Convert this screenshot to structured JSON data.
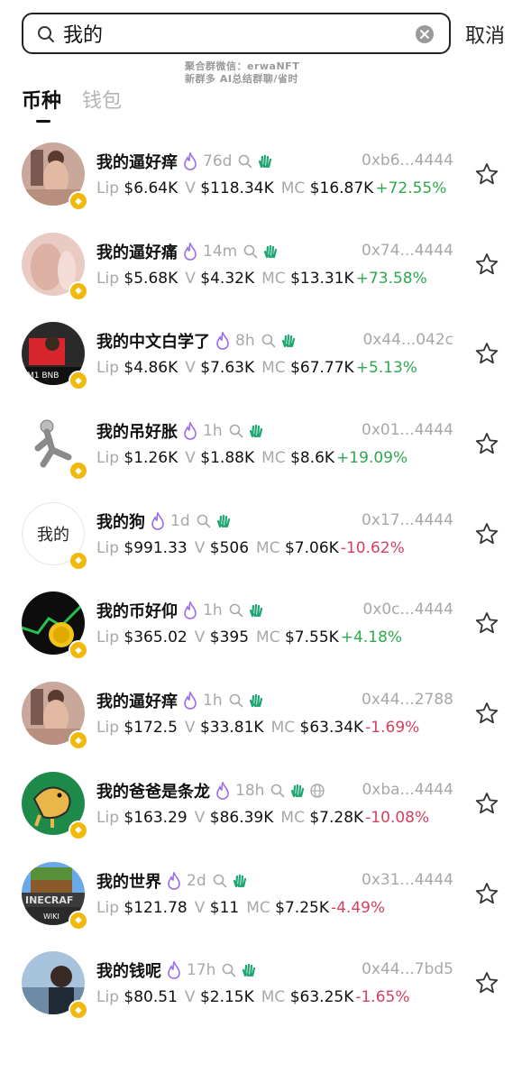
{
  "search": {
    "value": "我的",
    "cancel_label": "取消"
  },
  "watermark": {
    "line1": "聚合群微信：erwaNFT",
    "line2": "新群多 AI总结群聊/省时"
  },
  "tabs": [
    {
      "label": "币种"
    },
    {
      "label": "钱包"
    }
  ],
  "colors": {
    "positive": "#2fa84f",
    "negative": "#d6405f",
    "fire": "#9b6cf0",
    "hand": "#1ea672",
    "badge": "#f0b90b"
  },
  "tokens": [
    {
      "name": "我的逼好痒",
      "age": "76d",
      "addr": "0xb6...4444",
      "lip_label": "Lip",
      "lip": "$6.64K",
      "v_label": "V",
      "v": "$118.34K",
      "mc_label": "MC",
      "mc": "$16.87K",
      "change": "+72.55%",
      "dir": "pos",
      "avatar": "photo-skin",
      "globe": false
    },
    {
      "name": "我的逼好痛",
      "age": "14m",
      "addr": "0x74...4444",
      "lip_label": "Lip",
      "lip": "$5.68K",
      "v_label": "V",
      "v": "$4.32K",
      "mc_label": "MC",
      "mc": "$13.31K",
      "change": "+73.58%",
      "dir": "pos",
      "avatar": "photo-pink",
      "globe": false
    },
    {
      "name": "我的中文白学了",
      "age": "8h",
      "addr": "0x44...042c",
      "lip_label": "Lip",
      "lip": "$4.86K",
      "v_label": "V",
      "v": "$7.63K",
      "mc_label": "MC",
      "mc": "$67.77K",
      "change": "+5.13%",
      "dir": "pos",
      "avatar": "photo-red",
      "globe": false
    },
    {
      "name": "我的吊好胀",
      "age": "1h",
      "addr": "0x01...4444",
      "lip_label": "Lip",
      "lip": "$1.26K",
      "v_label": "V",
      "v": "$1.88K",
      "mc_label": "MC",
      "mc": "$8.6K",
      "change": "+19.09%",
      "dir": "pos",
      "avatar": "figure-grey",
      "globe": false
    },
    {
      "name": "我的狗",
      "age": "1d",
      "addr": "0x17...4444",
      "lip_label": "Lip",
      "lip": "$991.33",
      "v_label": "V",
      "v": "$506",
      "mc_label": "MC",
      "mc": "$7.06K",
      "change": "-10.62%",
      "dir": "neg",
      "avatar": "text",
      "avatar_text": "我的",
      "globe": false
    },
    {
      "name": "我的币好仰",
      "age": "1h",
      "addr": "0x0c...4444",
      "lip_label": "Lip",
      "lip": "$365.02",
      "v_label": "V",
      "v": "$395",
      "mc_label": "MC",
      "mc": "$7.55K",
      "change": "+4.18%",
      "dir": "pos",
      "avatar": "coin-dark",
      "globe": false
    },
    {
      "name": "我的逼好痒",
      "age": "1h",
      "addr": "0x44...2788",
      "lip_label": "Lip",
      "lip": "$172.5",
      "v_label": "V",
      "v": "$33.81K",
      "mc_label": "MC",
      "mc": "$63.34K",
      "change": "-1.69%",
      "dir": "neg",
      "avatar": "photo-skin",
      "globe": false
    },
    {
      "name": "我的爸爸是条龙",
      "age": "18h",
      "addr": "0xba...4444",
      "lip_label": "Lip",
      "lip": "$163.29",
      "v_label": "V",
      "v": "$86.39K",
      "mc_label": "MC",
      "mc": "$7.28K",
      "change": "-10.08%",
      "dir": "neg",
      "avatar": "dragon-green",
      "globe": true
    },
    {
      "name": "我的世界",
      "age": "2d",
      "addr": "0x31...4444",
      "lip_label": "Lip",
      "lip": "$121.78",
      "v_label": "V",
      "v": "$11",
      "mc_label": "MC",
      "mc": "$7.25K",
      "change": "-4.49%",
      "dir": "neg",
      "avatar": "minecraft",
      "globe": false
    },
    {
      "name": "我的钱呢",
      "age": "17h",
      "addr": "0x44...7bd5",
      "lip_label": "Lip",
      "lip": "$80.51",
      "v_label": "V",
      "v": "$2.15K",
      "mc_label": "MC",
      "mc": "$63.25K",
      "change": "-1.65%",
      "dir": "neg",
      "avatar": "photo-blue",
      "globe": false
    }
  ]
}
